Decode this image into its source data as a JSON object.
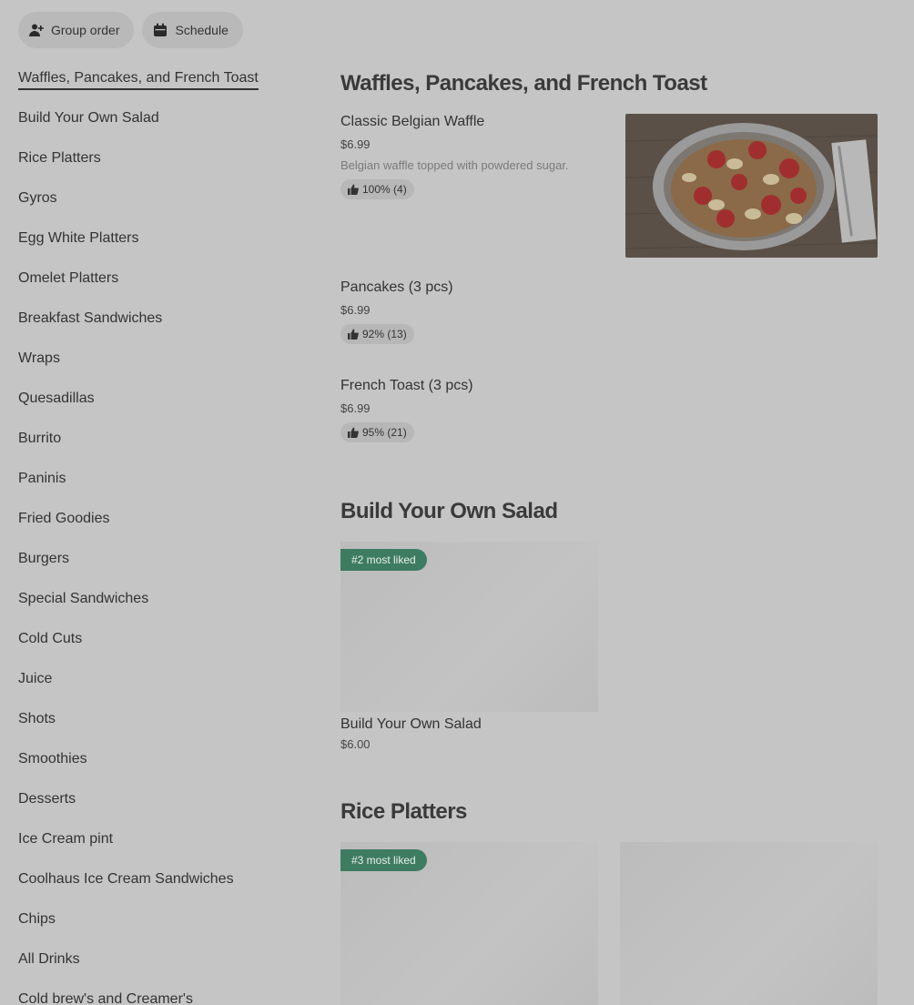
{
  "top": {
    "group_order": "Group order",
    "schedule": "Schedule"
  },
  "sidebar": {
    "items": [
      {
        "label": "Waffles, Pancakes, and French Toast"
      },
      {
        "label": "Build Your Own Salad"
      },
      {
        "label": "Rice Platters"
      },
      {
        "label": "Gyros"
      },
      {
        "label": "Egg White Platters"
      },
      {
        "label": "Omelet Platters"
      },
      {
        "label": "Breakfast Sandwiches"
      },
      {
        "label": "Wraps"
      },
      {
        "label": "Quesadillas"
      },
      {
        "label": "Burrito"
      },
      {
        "label": "Paninis"
      },
      {
        "label": "Fried Goodies"
      },
      {
        "label": "Burgers"
      },
      {
        "label": "Special Sandwiches"
      },
      {
        "label": "Cold Cuts"
      },
      {
        "label": "Juice"
      },
      {
        "label": "Shots"
      },
      {
        "label": "Smoothies"
      },
      {
        "label": "Desserts"
      },
      {
        "label": "Ice Cream pint"
      },
      {
        "label": "Coolhaus Ice Cream Sandwiches"
      },
      {
        "label": "Chips"
      },
      {
        "label": "All Drinks"
      },
      {
        "label": "Cold brew's and Creamer's"
      }
    ]
  },
  "sections": {
    "waffles": {
      "title": "Waffles, Pancakes, and French Toast",
      "items": [
        {
          "name": "Classic Belgian Waffle",
          "price": "$6.99",
          "desc": "Belgian waffle topped with powdered sugar.",
          "rating": "100% (4)"
        },
        {
          "name": "Pancakes (3 pcs)",
          "price": "$6.99",
          "rating": "92% (13)"
        },
        {
          "name": "French Toast (3 pcs)",
          "price": "$6.99",
          "rating": "95% (21)"
        }
      ]
    },
    "salad": {
      "title": "Build Your Own Salad",
      "badge": "#2 most liked",
      "items": [
        {
          "name": "Build Your Own Salad",
          "price": "$6.00"
        }
      ]
    },
    "rice": {
      "title": "Rice Platters",
      "badge": "#3 most liked"
    }
  },
  "icons": {
    "group_order": "person-add-icon",
    "schedule": "calendar-icon",
    "rating": "thumbs-up-icon"
  },
  "colors": {
    "badge_bg": "#3e7c62",
    "page_bg": "#c5c5c5"
  }
}
